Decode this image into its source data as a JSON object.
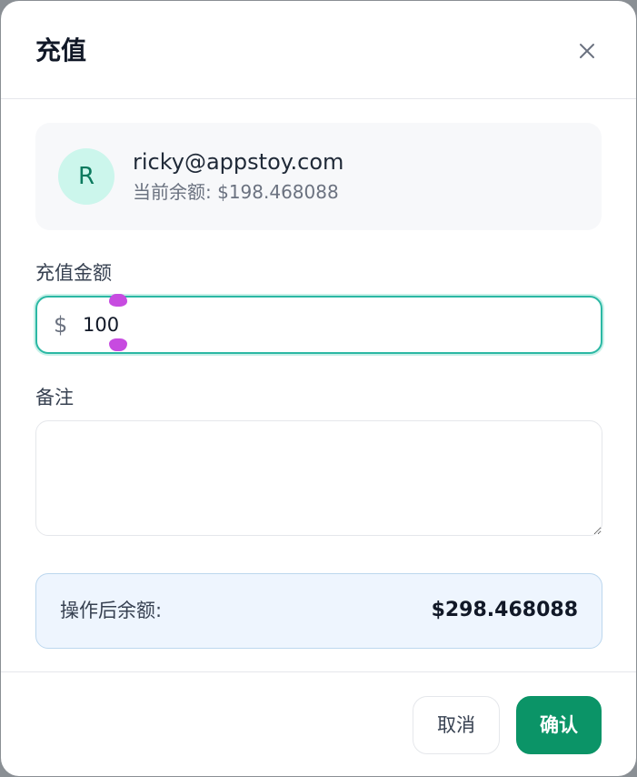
{
  "dialog": {
    "title": "充值",
    "close_icon": "close-icon"
  },
  "user": {
    "avatar_initial": "R",
    "email": "ricky@appstoy.com",
    "balance_text": "当前余额: $198.468088"
  },
  "amount": {
    "label": "充值金额",
    "currency_symbol": "$",
    "value": "100"
  },
  "note": {
    "label": "备注",
    "value": ""
  },
  "result": {
    "label": "操作后余额:",
    "value": "$298.468088"
  },
  "actions": {
    "cancel_label": "取消",
    "confirm_label": "确认"
  },
  "colors": {
    "accent": "#0b9467",
    "focus_border": "#2bb8a4",
    "avatar_bg": "#ccf6ec",
    "result_bg": "#eef5fe"
  }
}
